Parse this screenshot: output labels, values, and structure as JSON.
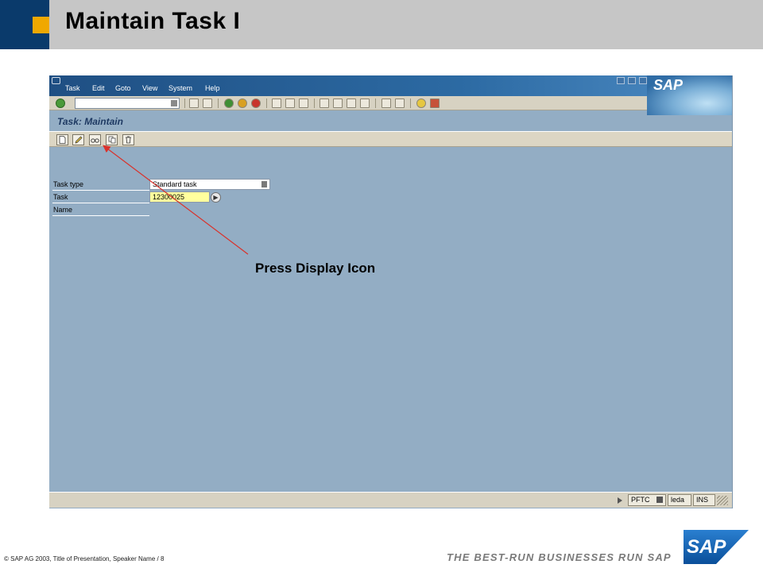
{
  "slide": {
    "title": "Maintain Task I",
    "footer": "© SAP AG 2003, Title of Presentation, Speaker Name / 8",
    "tagline": "THE BEST-RUN BUSINESSES RUN SAP",
    "logo_text": "SAP"
  },
  "sapgui": {
    "menu": [
      "Task",
      "Edit",
      "Goto",
      "View",
      "System",
      "Help"
    ],
    "logo_text": "SAP",
    "screen_title": "Task: Maintain",
    "fields": {
      "task_type_label": "Task type",
      "task_type_value": "Standard task",
      "task_label": "Task",
      "task_value": "12300025",
      "name_label": "Name"
    },
    "status": {
      "system": "PFTC",
      "client": "leda",
      "mode": "INS"
    }
  },
  "annotation": {
    "text": "Press Display Icon",
    "line_color": "#d9322b"
  },
  "colors": {
    "header_navy": "#0a3a6b",
    "header_orange": "#f0a800",
    "sap_blue": "#93adc4"
  }
}
